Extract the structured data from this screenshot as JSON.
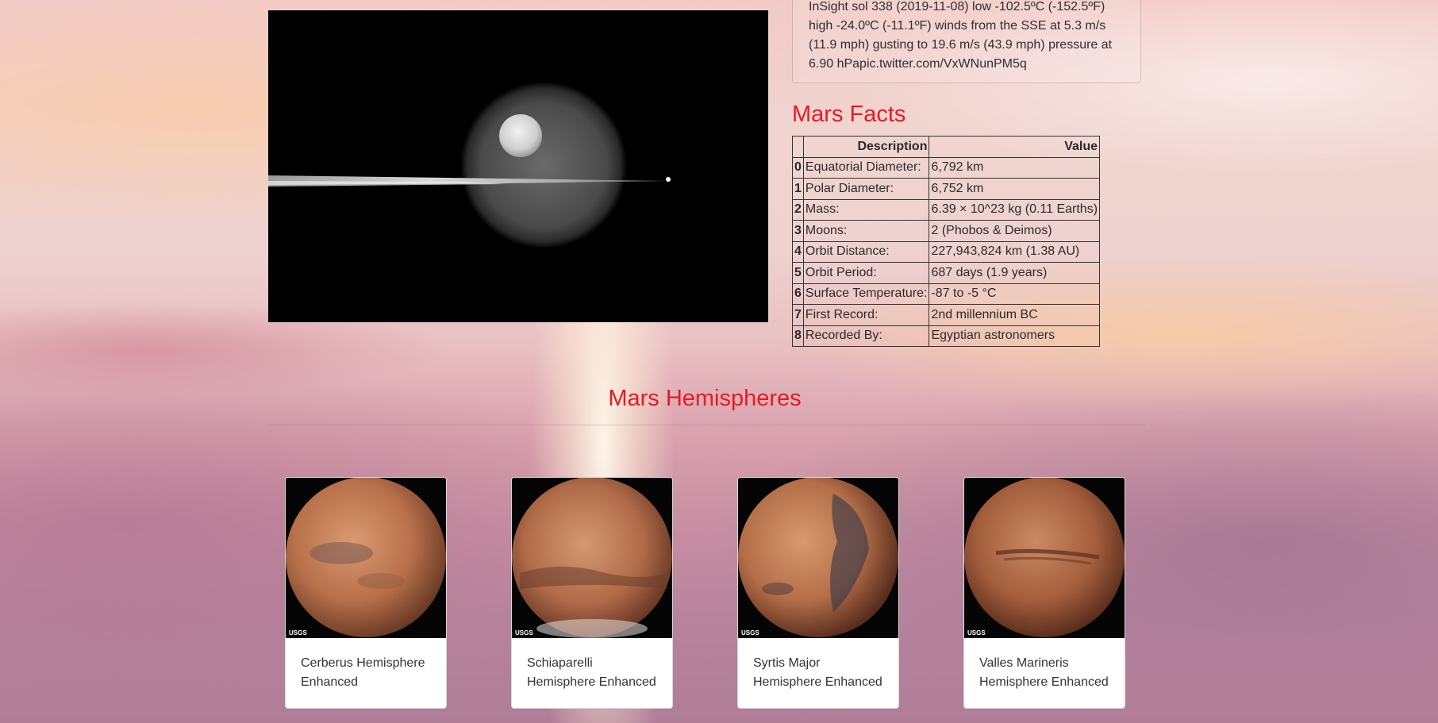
{
  "weather": {
    "text_line1": "InSight sol 338 (2019-11-08) low -102.5ºC (-152.5ºF)",
    "text_line2": "high -24.0ºC (-11.1ºF) winds from the SSE at 5.3 m/s",
    "text_line3": "(11.9 mph) gusting to 19.6 m/s (43.9 mph) pressure at",
    "text_line4": "6.90 hPapic.twitter.com/VxWNunPM5q"
  },
  "featured_image": {
    "icon": "saturn-moon-photo"
  },
  "facts": {
    "heading": "Mars Facts",
    "col_index": "",
    "col_description": "Description",
    "col_value": "Value",
    "rows": [
      {
        "idx": "0",
        "desc": "Equatorial Diameter:",
        "val": "6,792 km"
      },
      {
        "idx": "1",
        "desc": "Polar Diameter:",
        "val": "6,752 km"
      },
      {
        "idx": "2",
        "desc": "Mass:",
        "val": "6.39 × 10^23 kg (0.11 Earths)"
      },
      {
        "idx": "3",
        "desc": "Moons:",
        "val": "2 (Phobos & Deimos)"
      },
      {
        "idx": "4",
        "desc": "Orbit Distance:",
        "val": "227,943,824 km (1.38 AU)"
      },
      {
        "idx": "5",
        "desc": "Orbit Period:",
        "val": "687 days (1.9 years)"
      },
      {
        "idx": "6",
        "desc": "Surface Temperature:",
        "val": "-87 to -5 °C"
      },
      {
        "idx": "7",
        "desc": "First Record:",
        "val": "2nd millennium BC"
      },
      {
        "idx": "8",
        "desc": "Recorded By:",
        "val": "Egyptian astronomers"
      }
    ]
  },
  "hemispheres": {
    "heading": "Mars Hemispheres",
    "items": [
      {
        "line1": "Cerberus Hemisphere",
        "line2": "Enhanced"
      },
      {
        "line1": "Schiaparelli",
        "line2": "Hemisphere Enhanced"
      },
      {
        "line1": "Syrtis Major",
        "line2": "Hemisphere Enhanced"
      },
      {
        "line1": "Valles Marineris",
        "line2": "Hemisphere Enhanced"
      }
    ],
    "logo_text": "USGS"
  },
  "colors": {
    "accent_red": "#e51b23"
  }
}
